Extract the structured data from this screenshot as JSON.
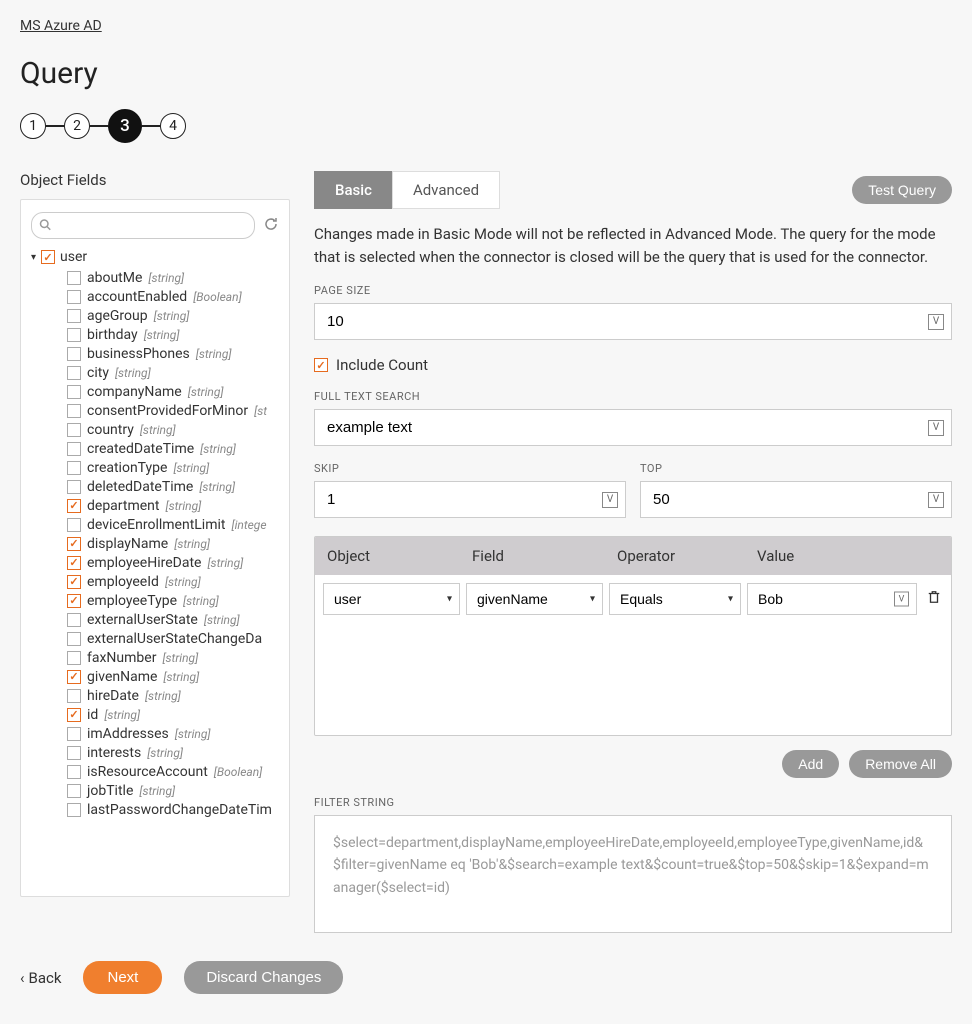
{
  "breadcrumb": {
    "label": "MS Azure AD"
  },
  "page_title": "Query",
  "steps": [
    "1",
    "2",
    "3",
    "4"
  ],
  "active_step": 2,
  "left": {
    "title": "Object Fields",
    "search_placeholder": "",
    "root": {
      "label": "user",
      "checked": true
    },
    "fields": [
      {
        "name": "aboutMe",
        "type": "[string]",
        "checked": false
      },
      {
        "name": "accountEnabled",
        "type": "[Boolean]",
        "checked": false
      },
      {
        "name": "ageGroup",
        "type": "[string]",
        "checked": false
      },
      {
        "name": "birthday",
        "type": "[string]",
        "checked": false
      },
      {
        "name": "businessPhones",
        "type": "[string]",
        "checked": false
      },
      {
        "name": "city",
        "type": "[string]",
        "checked": false
      },
      {
        "name": "companyName",
        "type": "[string]",
        "checked": false
      },
      {
        "name": "consentProvidedForMinor",
        "type": "[st",
        "checked": false
      },
      {
        "name": "country",
        "type": "[string]",
        "checked": false
      },
      {
        "name": "createdDateTime",
        "type": "[string]",
        "checked": false
      },
      {
        "name": "creationType",
        "type": "[string]",
        "checked": false
      },
      {
        "name": "deletedDateTime",
        "type": "[string]",
        "checked": false
      },
      {
        "name": "department",
        "type": "[string]",
        "checked": true
      },
      {
        "name": "deviceEnrollmentLimit",
        "type": "[intege",
        "checked": false
      },
      {
        "name": "displayName",
        "type": "[string]",
        "checked": true
      },
      {
        "name": "employeeHireDate",
        "type": "[string]",
        "checked": true
      },
      {
        "name": "employeeId",
        "type": "[string]",
        "checked": true
      },
      {
        "name": "employeeType",
        "type": "[string]",
        "checked": true
      },
      {
        "name": "externalUserState",
        "type": "[string]",
        "checked": false
      },
      {
        "name": "externalUserStateChangeDa",
        "type": "",
        "checked": false
      },
      {
        "name": "faxNumber",
        "type": "[string]",
        "checked": false
      },
      {
        "name": "givenName",
        "type": "[string]",
        "checked": true
      },
      {
        "name": "hireDate",
        "type": "[string]",
        "checked": false
      },
      {
        "name": "id",
        "type": "[string]",
        "checked": true
      },
      {
        "name": "imAddresses",
        "type": "[string]",
        "checked": false
      },
      {
        "name": "interests",
        "type": "[string]",
        "checked": false
      },
      {
        "name": "isResourceAccount",
        "type": "[Boolean]",
        "checked": false
      },
      {
        "name": "jobTitle",
        "type": "[string]",
        "checked": false
      },
      {
        "name": "lastPasswordChangeDateTim",
        "type": "",
        "checked": false
      }
    ]
  },
  "tabs": {
    "basic": "Basic",
    "advanced": "Advanced"
  },
  "test_query": "Test Query",
  "info": "Changes made in Basic Mode will not be reflected in Advanced Mode. The query for the mode that is selected when the connector is closed will be the query that is used for the connector.",
  "page_size": {
    "label": "PAGE SIZE",
    "value": "10"
  },
  "include_count": {
    "label": "Include Count",
    "checked": true
  },
  "full_text": {
    "label": "FULL TEXT SEARCH",
    "value": "example text"
  },
  "skip": {
    "label": "SKIP",
    "value": "1"
  },
  "top": {
    "label": "TOP",
    "value": "50"
  },
  "filter_table": {
    "headers": {
      "object": "Object",
      "field": "Field",
      "operator": "Operator",
      "value": "Value"
    },
    "row": {
      "object": "user",
      "field": "givenName",
      "operator": "Equals",
      "value": "Bob"
    }
  },
  "actions": {
    "add": "Add",
    "remove_all": "Remove All"
  },
  "filter_string": {
    "label": "FILTER STRING",
    "value": "$select=department,displayName,employeeHireDate,employeeId,employeeType,givenName,id&$filter=givenName eq 'Bob'&$search=example text&$count=true&$top=50&$skip=1&$expand=manager($select=id)"
  },
  "footer": {
    "back": "Back",
    "next": "Next",
    "discard": "Discard Changes"
  }
}
